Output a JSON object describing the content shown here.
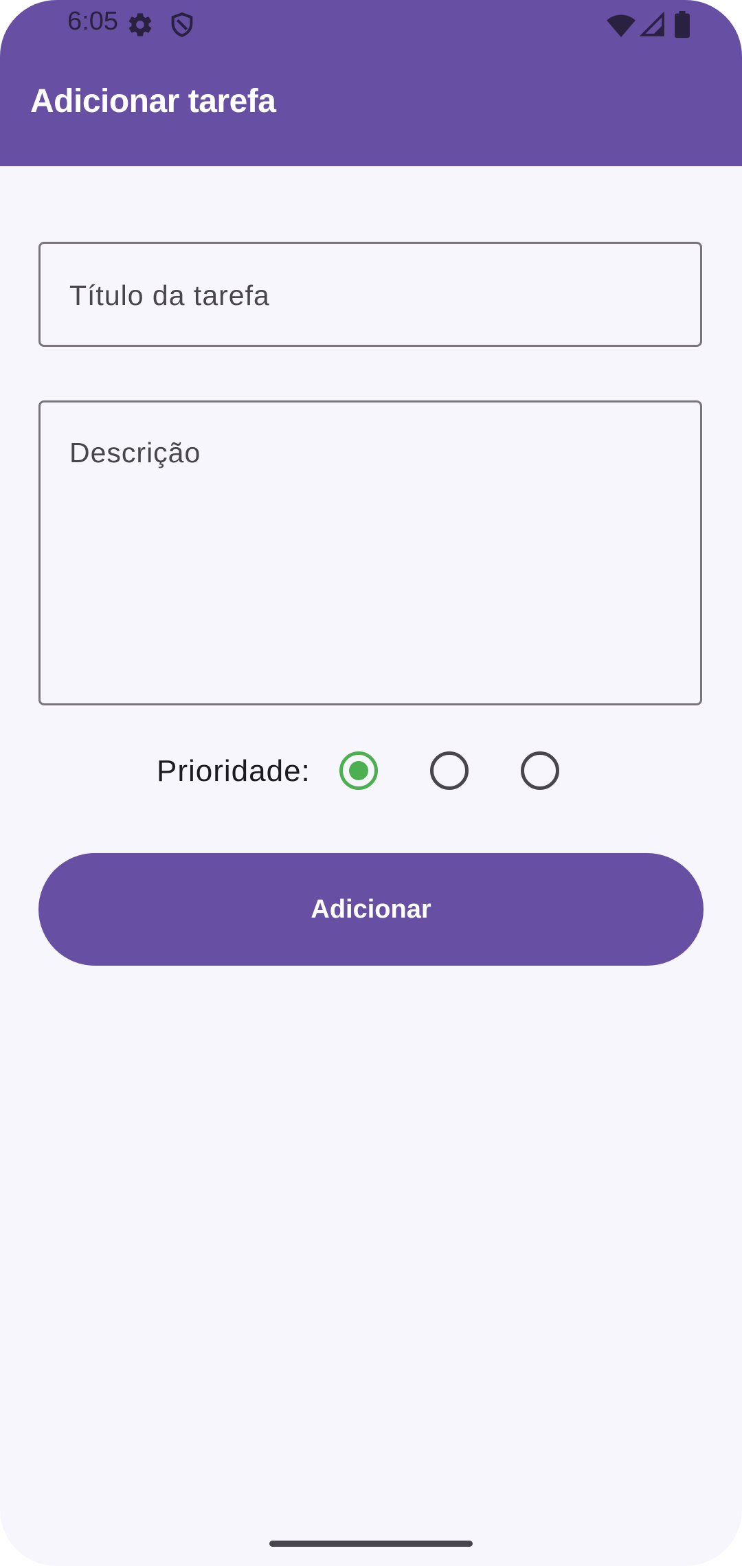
{
  "status_bar": {
    "time": "6:05",
    "icons": [
      "gear-icon",
      "shield-icon",
      "wifi-icon",
      "signal-icon",
      "battery-icon"
    ]
  },
  "app_bar": {
    "title": "Adicionar tarefa",
    "color": "#6750a4"
  },
  "form": {
    "title_field": {
      "placeholder": "Título da tarefa",
      "value": ""
    },
    "description_field": {
      "placeholder": "Descrição",
      "value": ""
    },
    "priority": {
      "label": "Prioridade:",
      "options": [
        {
          "checked": true,
          "color": "#4caf50"
        },
        {
          "checked": false
        },
        {
          "checked": false
        }
      ]
    },
    "submit_label": "Adicionar"
  }
}
